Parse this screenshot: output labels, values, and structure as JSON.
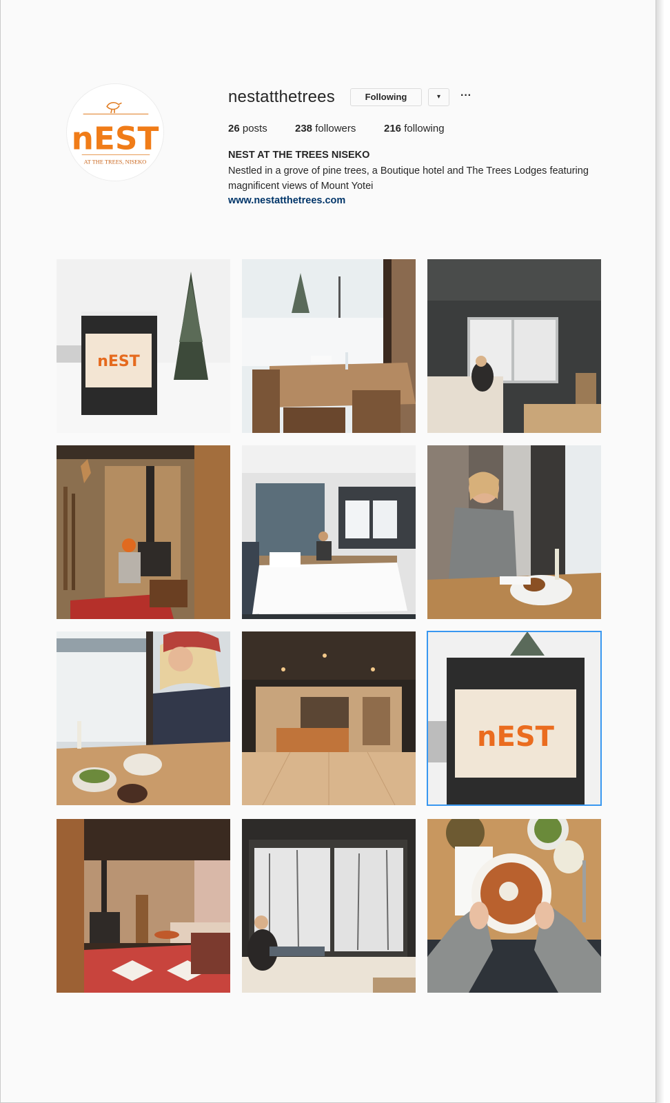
{
  "profile": {
    "username": "nestatthetrees",
    "follow_label": "Following",
    "dropdown_glyph": "▾",
    "more_glyph": "···",
    "posts_count": "26",
    "posts_label": "posts",
    "followers_count": "238",
    "followers_label": "followers",
    "following_count": "216",
    "following_label": "following",
    "full_name": "NEST AT THE TREES NISEKO",
    "bio": "Nestled in a grove of pine trees, a Boutique hotel and The Trees Lodges featuring magnificent views of Mount Yotei",
    "website": "www.nestatthetrees.com"
  },
  "avatar_logo": {
    "wordmark": "nEST",
    "tagline": "AT THE TREES, NISEKO"
  },
  "posts": [
    {
      "subject": "snowy-outdoor-sign"
    },
    {
      "subject": "dining-table-window"
    },
    {
      "subject": "lounge-window-view"
    },
    {
      "subject": "fireplace-deer-trophy"
    },
    {
      "subject": "hotel-bedroom"
    },
    {
      "subject": "woman-wine-meal"
    },
    {
      "subject": "woman-red-beanie-dining"
    },
    {
      "subject": "lobby-reception"
    },
    {
      "subject": "sign-closeup"
    },
    {
      "subject": "living-room-fireplace-rug"
    },
    {
      "subject": "woman-window-snow-trees"
    },
    {
      "subject": "bowl-held-overhead"
    }
  ],
  "colors": {
    "brand_orange": "#f07c18",
    "link_blue": "#003569",
    "selection_blue": "#3897f0"
  }
}
